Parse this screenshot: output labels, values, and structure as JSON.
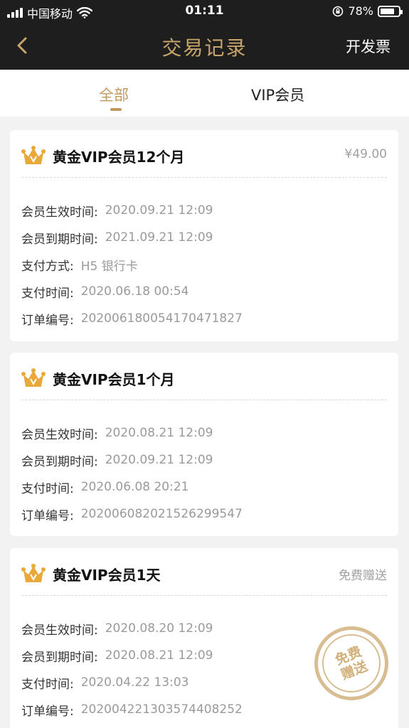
{
  "status_bar": {
    "carrier": "中国移动",
    "time": "01:11",
    "battery": "78%",
    "battery_level": 0.78
  },
  "nav": {
    "title": "交易记录",
    "right_action": "开发票"
  },
  "tabs": [
    {
      "label": "全部",
      "active": true
    },
    {
      "label": "VIP会员",
      "active": false
    }
  ],
  "cards": [
    {
      "title": "黄金VIP会员12个月",
      "price": "¥49.00",
      "rows": [
        {
          "label": "会员生效时间:",
          "value": "2020.09.21 12:09"
        },
        {
          "label": "会员到期时间:",
          "value": "2021.09.21 12:09"
        },
        {
          "label": "支付方式:",
          "value": "H5 银行卡"
        },
        {
          "label": "支付时间:",
          "value": "2020.06.18 00:54"
        },
        {
          "label": "订单编号:",
          "value": "20200618005417047182​7"
        }
      ]
    },
    {
      "title": "黄金VIP会员1个月",
      "rows": [
        {
          "label": "会员生效时间:",
          "value": "2020.08.21 12:09"
        },
        {
          "label": "会员到期时间:",
          "value": "2020.09.21 12:09"
        },
        {
          "label": "支付时间:",
          "value": "2020.06.08 20:21"
        },
        {
          "label": "订单编号:",
          "value": "20200608202152629954​7"
        }
      ]
    },
    {
      "title": "黄金VIP会员1天",
      "price": "免费赠送",
      "stamp": "免费赠送",
      "rows": [
        {
          "label": "会员生效时间:",
          "value": "2020.08.20 12:09"
        },
        {
          "label": "会员到期时间:",
          "value": "2020.08.21 12:09"
        },
        {
          "label": "支付时间:",
          "value": "2020.04.22 13:03"
        },
        {
          "label": "订单编号:",
          "value": "20200422130357440825​2"
        }
      ]
    }
  ],
  "colors": {
    "header_bg": "#1e1e1e",
    "gold": "#c09a5d",
    "crown": "#e9a83a"
  }
}
